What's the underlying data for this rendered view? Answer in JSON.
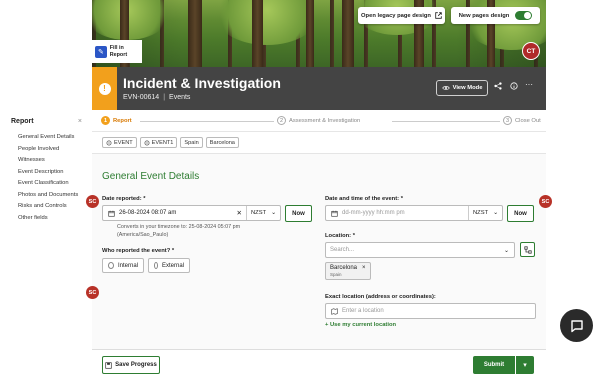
{
  "sidebar": {
    "title": "Report",
    "close": "×",
    "items": [
      {
        "label": "General Event Details"
      },
      {
        "label": "People Involved"
      },
      {
        "label": "Witnesses"
      },
      {
        "label": "Event Description"
      },
      {
        "label": "Event Classification"
      },
      {
        "label": "Photos and Documents"
      },
      {
        "label": "Risks and Controls"
      },
      {
        "label": "Other fields"
      }
    ]
  },
  "banner": {
    "fill_in_report": "Fill in Report",
    "legacy_button": "Open legacy page design",
    "new_pages_label": "New pages design",
    "new_pages_enabled": true,
    "avatar_initials": "CT"
  },
  "header": {
    "title": "Incident & Investigation",
    "record_id": "EVN-00614",
    "separator": "|",
    "module": "Events",
    "view_mode": "View Mode",
    "more": "···",
    "status_icon": "!"
  },
  "stepper": {
    "steps": [
      {
        "num": "1",
        "label": "Report",
        "active": true
      },
      {
        "num": "2",
        "label": "Assessment & Investigation",
        "active": false
      },
      {
        "num": "3",
        "label": "Close Out",
        "active": false
      }
    ]
  },
  "tags": {
    "items": [
      "EVENT",
      "EVENT1",
      "Spain",
      "Barcelona"
    ]
  },
  "form": {
    "section_title": "General Event Details",
    "date_reported": {
      "label": "Date reported: *",
      "value": "26-08-2024 08:07 am",
      "clear": "✕",
      "tz": "NZST",
      "now": "Now",
      "hint": "Converts in your timezone to: 25-08-2024 05:07 pm (America/Sao_Paulo)"
    },
    "date_event": {
      "label": "Date and time of the event: *",
      "placeholder": "dd-mm-yyyy hh:mm pm",
      "tz": "NZST",
      "now": "Now"
    },
    "who_reported": {
      "label": "Who reported the event? *",
      "options": [
        "Internal",
        "External"
      ]
    },
    "location": {
      "label": "Location: *",
      "placeholder": "Search...",
      "chip_main": "Barcelona",
      "chip_remove": "×",
      "chip_sub": "Spain"
    },
    "exact_location": {
      "label": "Exact location (address or coordinates):",
      "placeholder": "Enter a location",
      "use_current": "+ Use my current location"
    }
  },
  "footer": {
    "save": "Save Progress",
    "submit": "Submit",
    "caret": "▾"
  },
  "sc_badge": "SC",
  "colors": {
    "accent_green": "#2e7d32",
    "status_orange": "#f2a01c",
    "title_band": "#444444",
    "sc_red": "#b83228"
  }
}
